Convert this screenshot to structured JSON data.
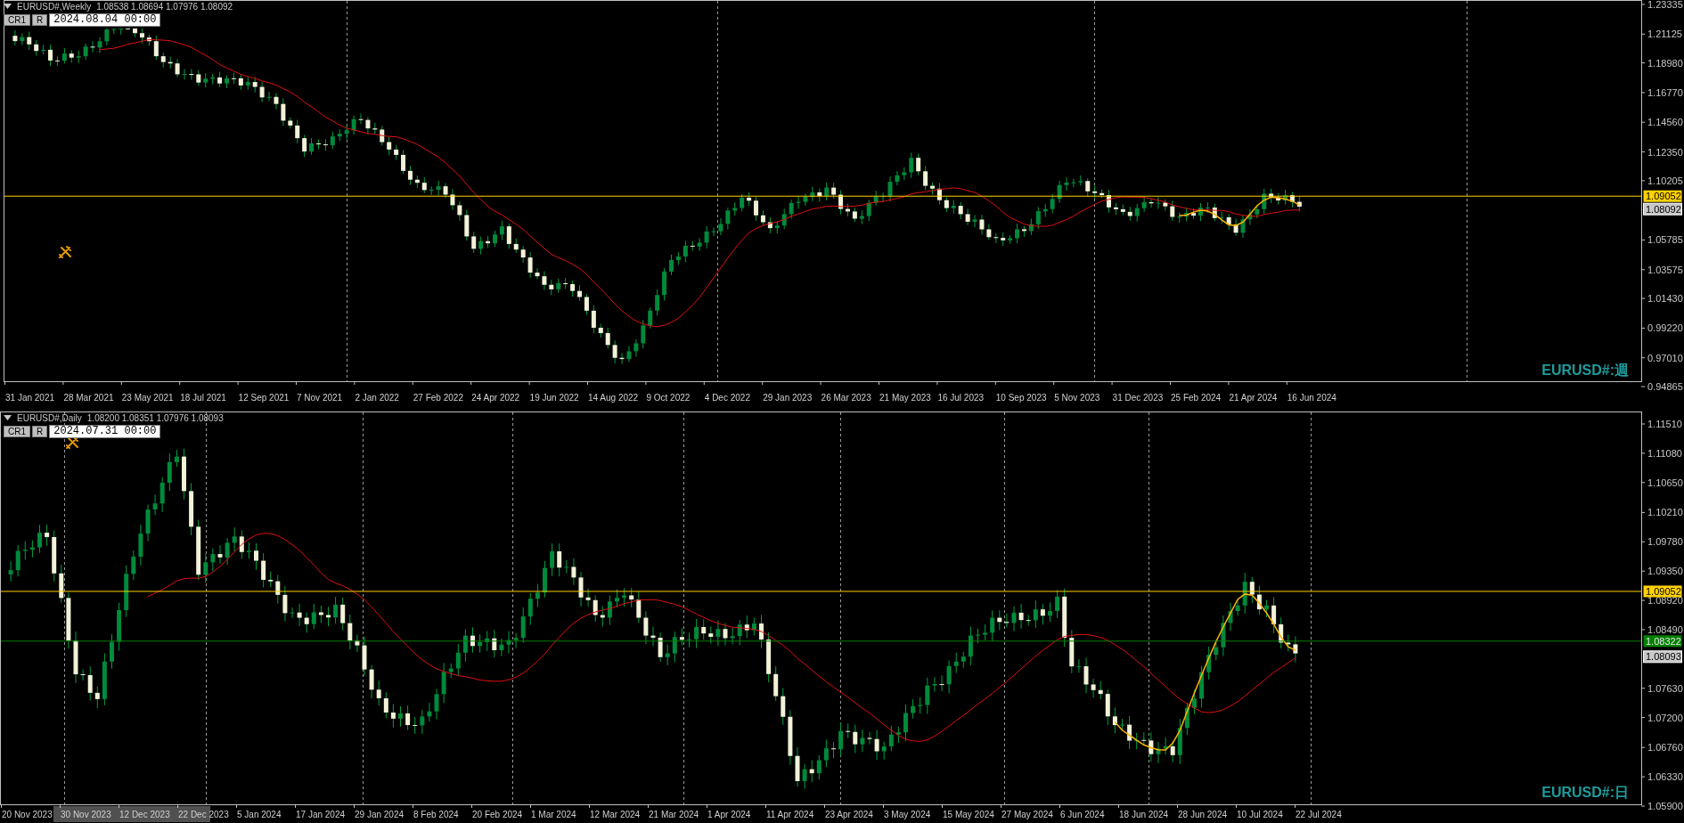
{
  "charts": [
    {
      "symbol": "EURUSD#,Weekly",
      "quote": "1.08538 1.08694 1.07976 1.08092",
      "buttons": [
        "CR1",
        "R"
      ],
      "date_field": "2024.08.04 00:00",
      "corner_label": "EURUSD#:週",
      "price_axis": [
        "1.23335",
        "1.21125",
        "1.18980",
        "1.16770",
        "1.14560",
        "1.12350",
        "1.10205",
        "1.05785",
        "1.03575",
        "1.01430",
        "0.99220",
        "0.97010",
        "0.94865"
      ],
      "price_tags": [
        {
          "text": "1.09052",
          "color": "#ffd200",
          "line": true
        },
        {
          "text": "1.08092",
          "color": "#c8c8c8",
          "line": false
        }
      ],
      "time_axis": [
        "31 Jan 2021",
        "28 Mar 2021",
        "23 May 2021",
        "18 Jul 2021",
        "12 Sep 2021",
        "7 Nov 2021",
        "2 Jan 2022",
        "27 Feb 2022",
        "24 Apr 2022",
        "19 Jun 2022",
        "14 Aug 2022",
        "9 Oct 2022",
        "4 Dec 2022",
        "29 Jan 2023",
        "26 Mar 2023",
        "21 May 2023",
        "16 Jul 2023",
        "10 Sep 2023",
        "5 Nov 2023",
        "31 Dec 2023",
        "25 Feb 2024",
        "21 Apr 2024",
        "16 Jun 2024"
      ]
    },
    {
      "symbol": "EURUSD#,Daily",
      "quote": "1.08200 1.08351 1.07976 1.08093",
      "buttons": [
        "CR1",
        "R"
      ],
      "date_field": "2024.07.31 00:00",
      "corner_label": "EURUSD#:日",
      "price_axis": [
        "1.11510",
        "1.11080",
        "1.10650",
        "1.10210",
        "1.09780",
        "1.09350",
        "1.08920",
        "1.08490",
        "1.07630",
        "1.07200",
        "1.06760",
        "1.06330",
        "1.05900"
      ],
      "price_tags": [
        {
          "text": "1.09052",
          "color": "#ffd200",
          "line": true
        },
        {
          "text": "1.08322",
          "color": "#008000",
          "line": true
        },
        {
          "text": "1.08093",
          "color": "#c8c8c8",
          "line": false
        }
      ],
      "time_axis": [
        "20 Nov 2023",
        "30 Nov 2023",
        "12 Dec 2023",
        "22 Dec 2023",
        "5 Jan 2024",
        "17 Jan 2024",
        "29 Jan 2024",
        "8 Feb 2024",
        "20 Feb 2024",
        "1 Mar 2024",
        "12 Mar 2024",
        "21 Mar 2024",
        "1 Apr 2024",
        "11 Apr 2024",
        "23 Apr 2024",
        "3 May 2024",
        "15 May 2024",
        "27 May 2024",
        "6 Jun 2024",
        "18 Jun 2024",
        "28 Jun 2024",
        "10 Jul 2024",
        "22 Jul 2024"
      ]
    }
  ]
}
